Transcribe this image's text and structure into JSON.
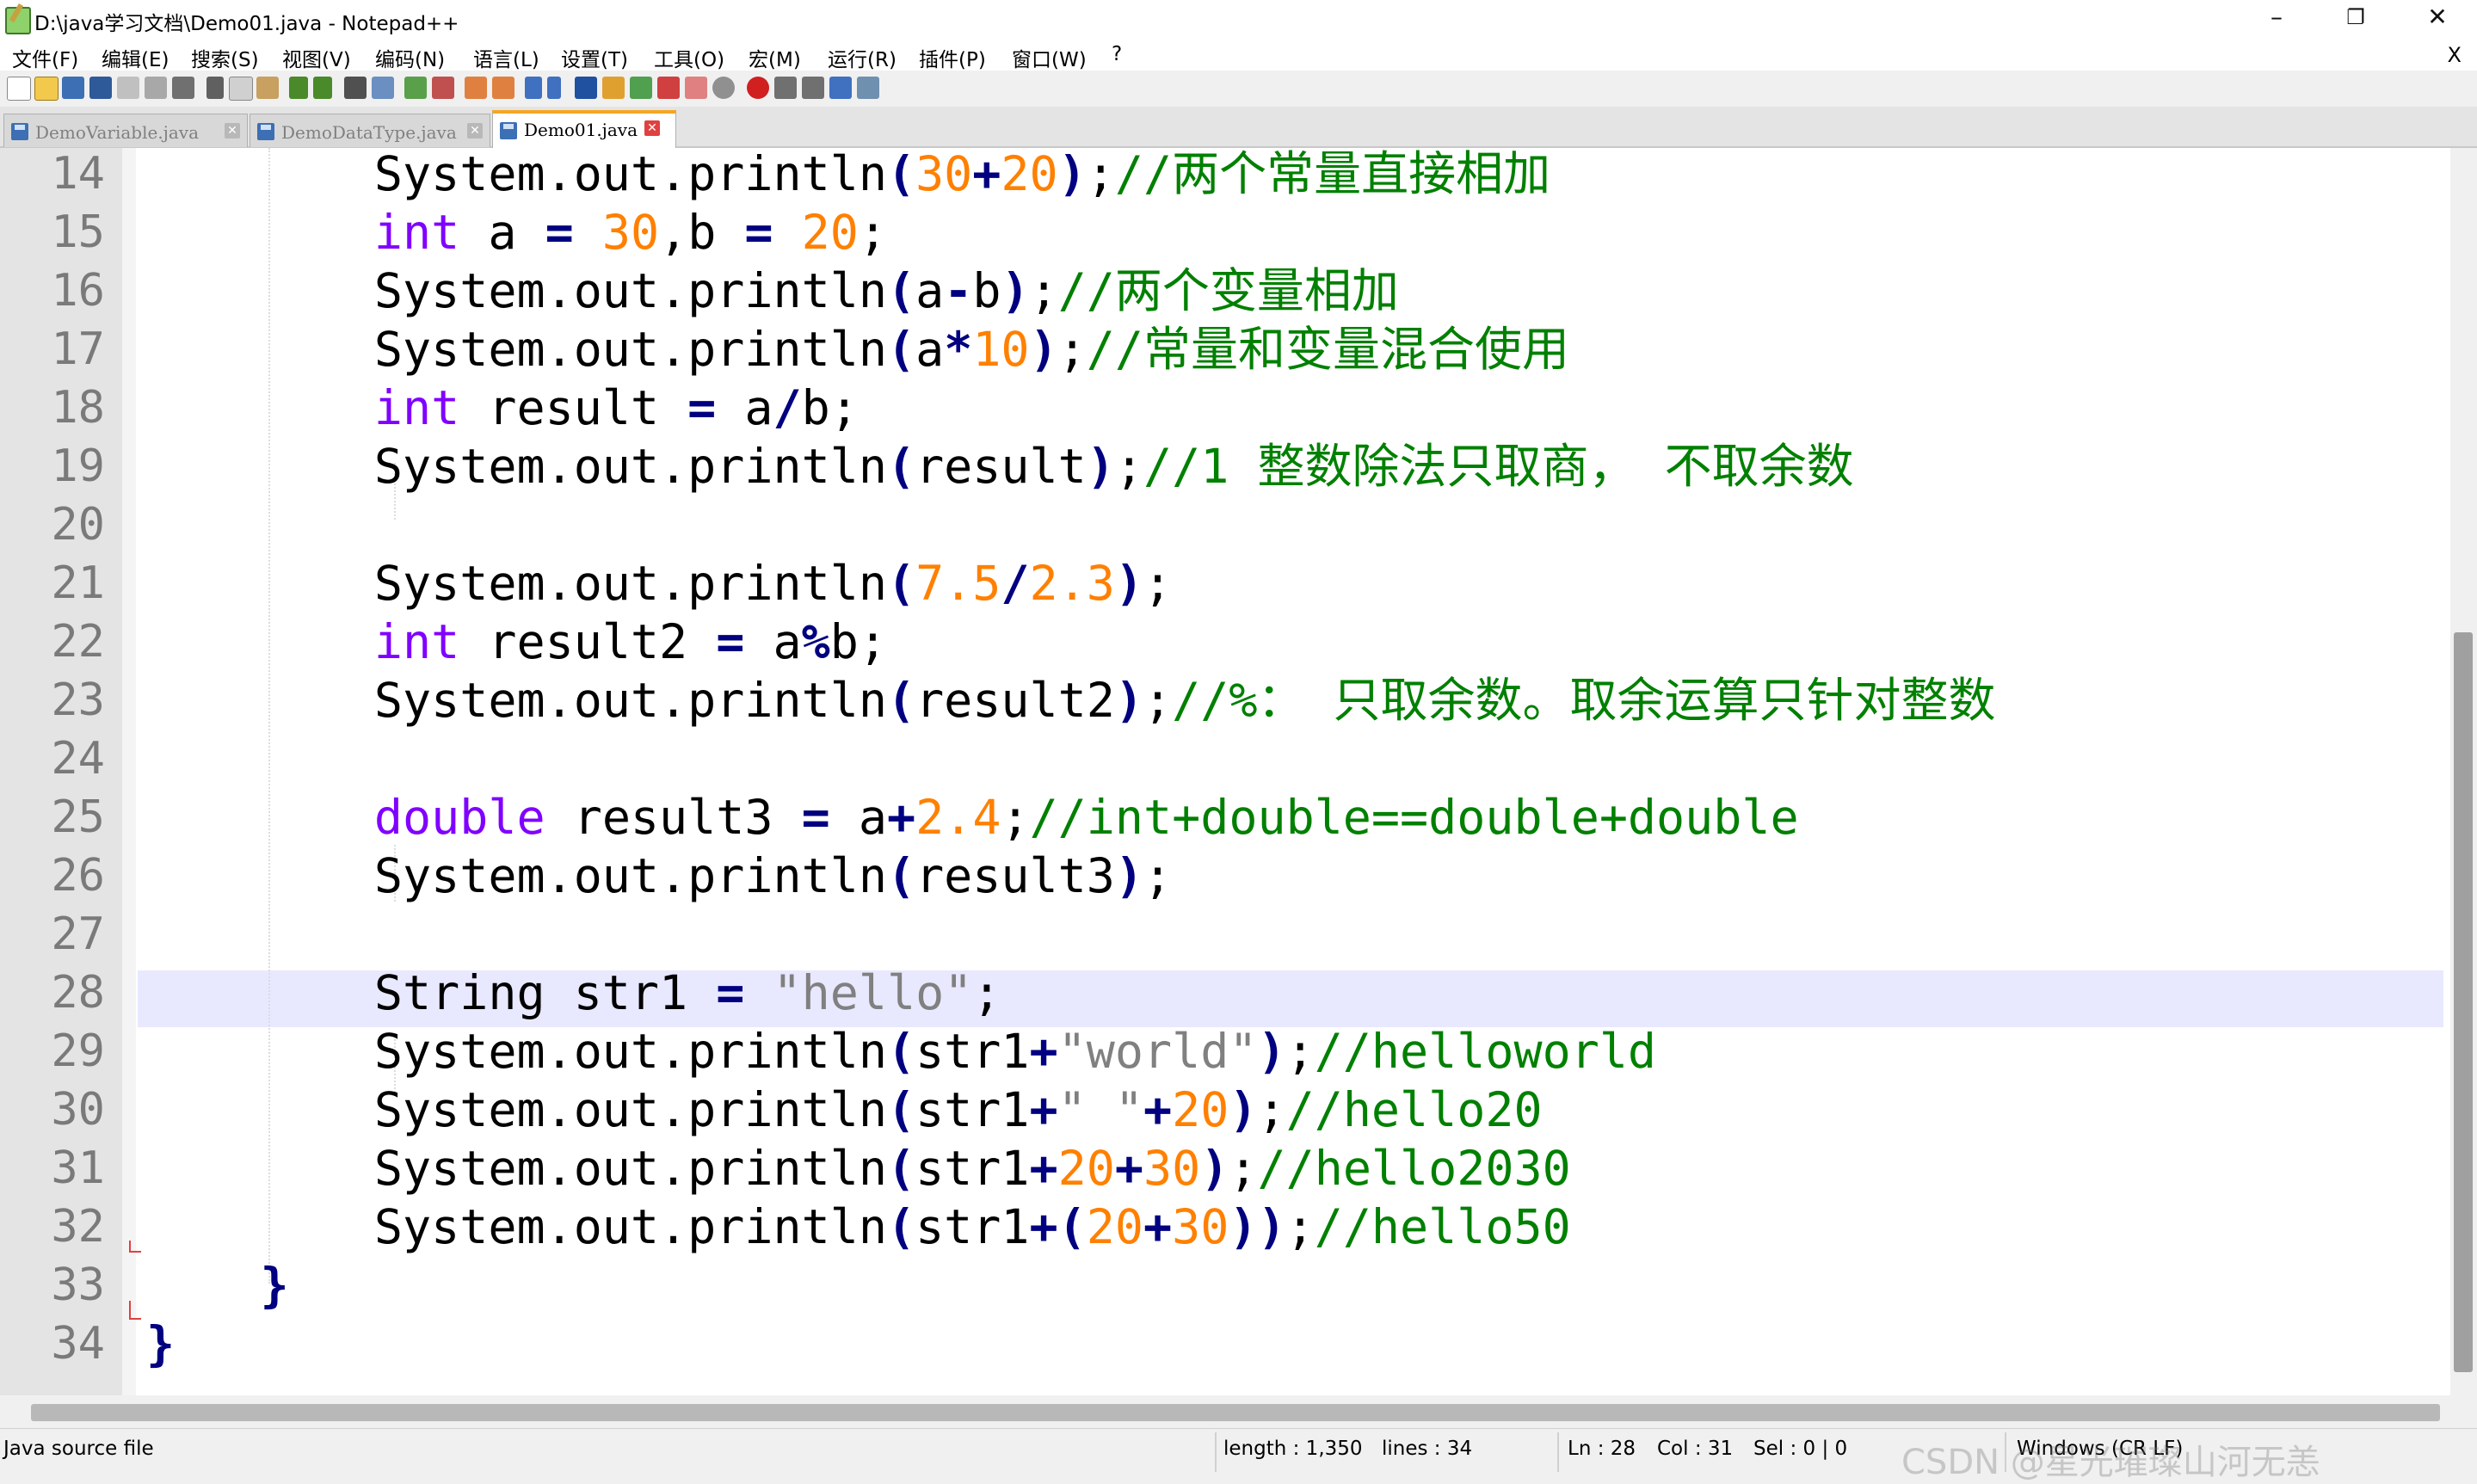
{
  "window": {
    "title": "D:\\java学习文档\\Demo01.java - Notepad++",
    "minimize": "–",
    "restore": "❐",
    "close": "✕"
  },
  "menu": {
    "items": [
      "文件(F)",
      "编辑(E)",
      "搜索(S)",
      "视图(V)",
      "编码(N)",
      "语言(L)",
      "设置(T)",
      "工具(O)",
      "宏(M)",
      "运行(R)",
      "插件(P)",
      "窗口(W)",
      "?"
    ],
    "close": "X"
  },
  "toolbar": {
    "icons": [
      "new-file-icon",
      "open-file-icon",
      "save-icon",
      "save-all-icon",
      "close-icon",
      "close-all-icon",
      "print-icon",
      "cut-icon",
      "copy-icon",
      "paste-icon",
      "undo-icon",
      "redo-icon",
      "find-icon",
      "replace-icon",
      "zoom-in-icon",
      "zoom-out-icon",
      "sync-v-icon",
      "sync-h-icon",
      "word-wrap-icon",
      "show-all-chars-icon",
      "indent-guide-icon",
      "udl-icon",
      "doc-map-icon",
      "func-list-icon",
      "folder-icon",
      "monitor-icon",
      "record-macro-icon",
      "stop-record-icon",
      "play-macro-icon",
      "run-macro-icon",
      "save-macro-icon"
    ]
  },
  "tabs": [
    {
      "label": "DemoVariable.java",
      "active": false
    },
    {
      "label": "DemoDataType.java",
      "active": false
    },
    {
      "label": "Demo01.java",
      "active": true
    }
  ],
  "editor": {
    "line_numbers": [
      "14",
      "15",
      "16",
      "17",
      "18",
      "19",
      "20",
      "21",
      "22",
      "23",
      "24",
      "25",
      "26",
      "27",
      "28",
      "29",
      "30",
      "31",
      "32",
      "33",
      "34"
    ],
    "current_line": "28"
  },
  "status": {
    "file_type": "Java source file",
    "length": "length : 1,350",
    "lines": "lines : 34",
    "ln": "Ln : 28",
    "col": "Col : 31",
    "sel": "Sel : 0 | 0",
    "eol": "Windows (CR LF)",
    "watermark": "CSDN @星光璀璨山河无恙"
  },
  "colors": {
    "keyword": "#8000ff",
    "number": "#ff8000",
    "operator": "#000080",
    "string": "#808080",
    "comment": "#008000",
    "current_line_bg": "#e8e8ff"
  }
}
